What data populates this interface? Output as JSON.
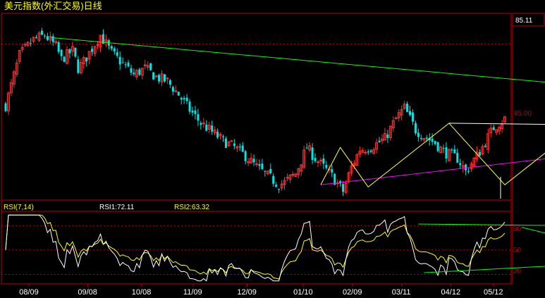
{
  "chart_data": [
    {
      "type": "candlestick",
      "title": "美元指数(外汇交易)日线",
      "price_labels": [
        "85.11",
        "85.00"
      ],
      "x_ticks": [
        "08/09",
        "09/08",
        "10/08",
        "11/09",
        "12/09",
        "01/10",
        "02/09",
        "03/11",
        "04/12",
        "05/12"
      ],
      "ylim": [
        78.0,
        86.3
      ],
      "bar_count": 180,
      "tick_bar_index": [
        10,
        35,
        58,
        80,
        103,
        127,
        148,
        169,
        190,
        213
      ],
      "colors": {
        "up": "#ff3030",
        "down": "#00e5e5",
        "frame": "#c00000"
      },
      "price_path": [
        [
          0,
          82.2
        ],
        [
          5,
          84.5
        ],
        [
          10,
          85.2
        ],
        [
          14,
          85.4
        ],
        [
          18,
          84.9
        ],
        [
          20,
          84.3
        ],
        [
          24,
          84.7
        ],
        [
          26,
          83.9
        ],
        [
          28,
          84.2
        ],
        [
          34,
          85.4
        ],
        [
          38,
          84.6
        ],
        [
          42,
          84.1
        ],
        [
          46,
          83.6
        ],
        [
          50,
          83.9
        ],
        [
          54,
          83.5
        ],
        [
          58,
          83.3
        ],
        [
          62,
          82.7
        ],
        [
          66,
          82.0
        ],
        [
          70,
          81.4
        ],
        [
          74,
          81.0
        ],
        [
          78,
          80.6
        ],
        [
          82,
          80.3
        ],
        [
          86,
          79.9
        ],
        [
          90,
          79.4
        ],
        [
          94,
          79.0
        ],
        [
          98,
          78.6
        ],
        [
          100,
          78.7
        ],
        [
          104,
          79.1
        ],
        [
          108,
          80.3
        ],
        [
          111,
          79.8
        ],
        [
          114,
          79.4
        ],
        [
          117,
          79.0
        ],
        [
          121,
          78.3
        ],
        [
          124,
          79.4
        ],
        [
          127,
          80.2
        ],
        [
          131,
          80.3
        ],
        [
          136,
          80.7
        ],
        [
          140,
          81.6
        ],
        [
          143,
          82.1
        ],
        [
          147,
          81.1
        ],
        [
          150,
          80.8
        ],
        [
          154,
          80.5
        ],
        [
          157,
          80.1
        ],
        [
          162,
          79.8
        ],
        [
          165,
          79.2
        ],
        [
          170,
          80.1
        ],
        [
          175,
          81.2
        ],
        [
          180,
          81.7
        ],
        [
          184,
          82.0
        ],
        [
          186,
          81.9
        ],
        [
          189,
          81.6
        ],
        [
          192,
          82.1
        ],
        [
          194,
          81.5
        ],
        [
          196,
          81.3
        ],
        [
          199,
          81.6
        ],
        [
          204,
          81.2
        ],
        [
          209,
          81.7
        ],
        [
          213,
          81.9
        ]
      ],
      "annotations": {
        "zigzag": [
          [
            113,
            78.6
          ],
          [
            120,
            80.3
          ],
          [
            130,
            78.5
          ],
          [
            159,
            81.4
          ],
          [
            179,
            78.6
          ],
          [
            207,
            81.4
          ],
          [
            219,
            81.0
          ],
          [
            229,
            81.4
          ]
        ],
        "arrow_target": [
          236,
          83.4
        ],
        "top_line": [
          [
            159,
            81.4
          ],
          [
            227,
            81.3
          ]
        ],
        "green_trend": [
          [
            16,
            85.3
          ],
          [
            252,
            82.6
          ]
        ],
        "magenta_trend": [
          [
            113,
            78.6
          ],
          [
            256,
            80.7
          ]
        ]
      }
    },
    {
      "type": "line",
      "title": "RSI(7,14)",
      "labels": [
        "RSI1:72.11",
        "RSI2:63.32"
      ],
      "y_ticks": [
        "80",
        "50",
        "20"
      ],
      "ylim": [
        10,
        95
      ],
      "series": [
        {
          "name": "RSI1",
          "last": 72.11,
          "color": "#ffffff"
        },
        {
          "name": "RSI2",
          "last": 63.32,
          "color": "#ffff00"
        }
      ]
    }
  ]
}
